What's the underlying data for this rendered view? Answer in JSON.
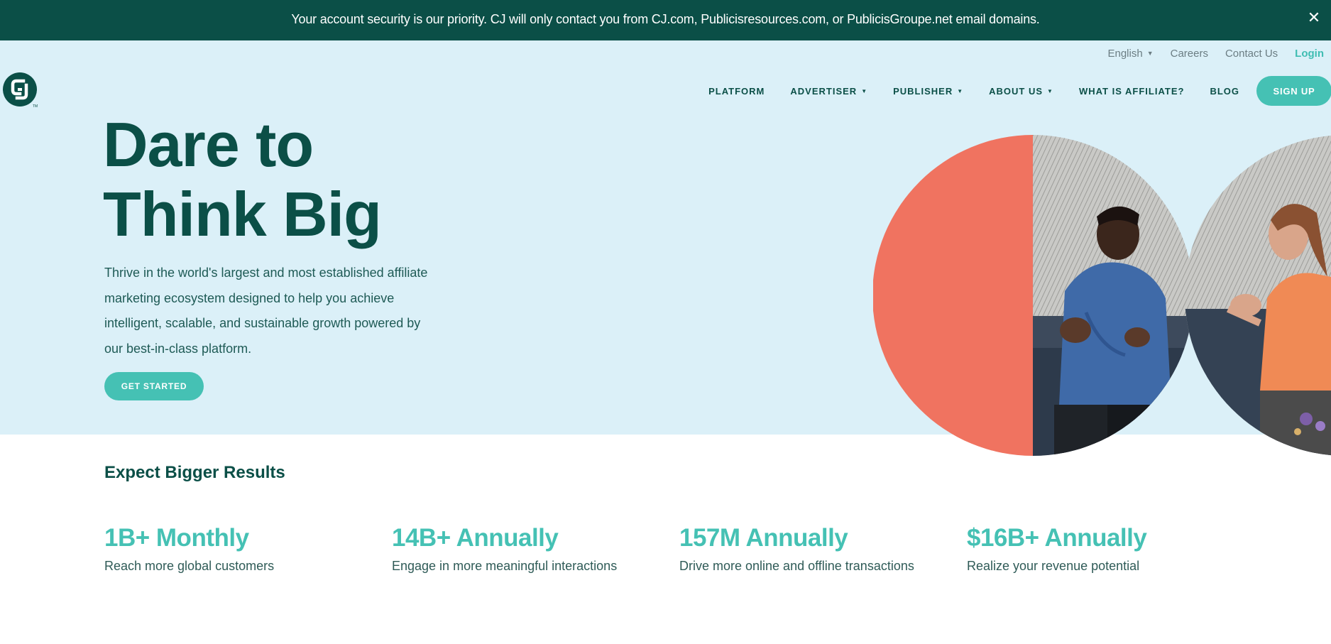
{
  "banner": {
    "message": "Your account security is our priority. CJ will only contact you from CJ.com, Publicisresources.com, or PublicisGroupe.net email domains.",
    "close_icon": "close-icon"
  },
  "utility_nav": {
    "language": "English",
    "careers": "Careers",
    "contact": "Contact Us",
    "login": "Login"
  },
  "logo": {
    "icon": "cj-logo"
  },
  "main_nav": {
    "items": [
      {
        "label": "PLATFORM",
        "dropdown": false
      },
      {
        "label": "ADVERTISER",
        "dropdown": true
      },
      {
        "label": "PUBLISHER",
        "dropdown": true
      },
      {
        "label": "ABOUT US",
        "dropdown": true
      },
      {
        "label": "WHAT IS AFFILIATE?",
        "dropdown": false
      },
      {
        "label": "BLOG",
        "dropdown": false
      }
    ],
    "signup": "SIGN UP"
  },
  "hero": {
    "title_line1": "Dare to",
    "title_line2": "Think Big",
    "description": "Thrive in the world's largest and most established affiliate marketing ecosystem designed to help you achieve intelligent, scalable, and sustainable growth powered by our best-in-class platform.",
    "cta": "GET STARTED"
  },
  "results": {
    "title": "Expect Bigger Results",
    "stats": [
      {
        "value": "1B+ Monthly",
        "label": "Reach more global customers"
      },
      {
        "value": "14B+ Annually",
        "label": "Engage in more meaningful interactions"
      },
      {
        "value": "157M Annually",
        "label": "Drive more online and offline transactions"
      },
      {
        "value": "$16B+ Annually",
        "label": "Realize your revenue potential"
      }
    ]
  },
  "colors": {
    "brand_dark": "#0b4f47",
    "accent_teal": "#45c1b4",
    "hero_bg": "#dbf0f8",
    "coral": "#f07360"
  }
}
